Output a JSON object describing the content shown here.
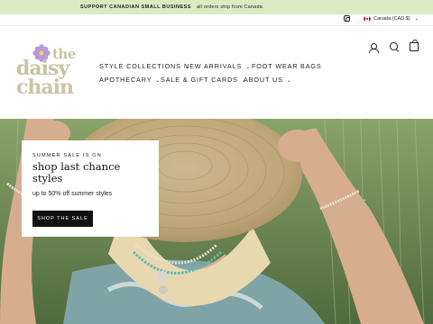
{
  "announcement": {
    "bold": "SUPPORT CANADIAN SMALL BUSINESS",
    "text": "all orders ship from Canada"
  },
  "utility": {
    "social_icon": "instagram-icon",
    "currency": "Canada (CAD $)"
  },
  "logo": {
    "line1": "the",
    "line2": "daisy",
    "line3": "chain"
  },
  "nav": {
    "items": [
      {
        "label": "STYLE COLLECTIONS",
        "has_dropdown": true
      },
      {
        "label": "NEW ARRIVALS",
        "has_dropdown": true
      },
      {
        "label": "FOOT WEAR",
        "has_dropdown": false
      },
      {
        "label": "BAGS",
        "has_dropdown": false
      },
      {
        "label": "APOTHECARY",
        "has_dropdown": true
      },
      {
        "label": "SALE & GIFT CARDS",
        "has_dropdown": true
      },
      {
        "label": "ABOUT US",
        "has_dropdown": true
      }
    ]
  },
  "header_icons": [
    "user-icon",
    "search-icon",
    "cart-icon"
  ],
  "hero": {
    "kicker": "SUMMER SALE IS ON",
    "headline": "shop last chance styles",
    "subtext": "up to 50% off summer styles",
    "cta": "SHOP THE SALE"
  },
  "colors": {
    "announcement_bg": "#d9ecc4",
    "logo": "#c9c5a3",
    "flower": "#b89ad6",
    "button": "#111111"
  }
}
